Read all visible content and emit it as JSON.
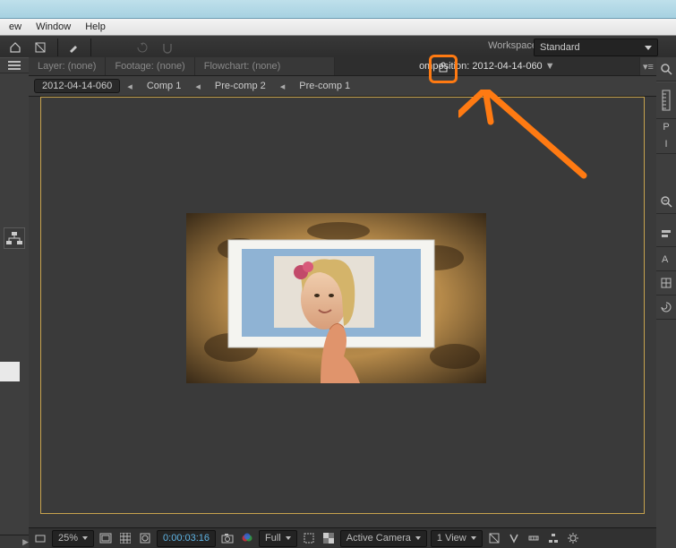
{
  "menu": {
    "view": "ew",
    "window": "Window",
    "help": "Help"
  },
  "toolbar": {
    "workspace_label": "Workspace:",
    "workspace_value": "Standard"
  },
  "tabs": {
    "layer_label": "Layer:",
    "layer_value": "(none)",
    "footage_label": "Footage:",
    "footage_value": "(none)",
    "flowchart_label": "Flowchart:",
    "flowchart_value": "(none)",
    "composition_label": "omposition:",
    "composition_value": "2012-04-14-060"
  },
  "breadcrumbs": [
    "2012-04-14-060",
    "Comp 1",
    "Pre-comp 2",
    "Pre-comp 1"
  ],
  "footer": {
    "zoom": "25%",
    "timecode": "0:00:03:16",
    "resolution": "Full",
    "camera": "Active Camera",
    "view": "1 View"
  },
  "right_letters": {
    "p": "P",
    "i": "I"
  },
  "icons": {
    "back": "◁",
    "play": "▶",
    "tri_left": "◂"
  }
}
